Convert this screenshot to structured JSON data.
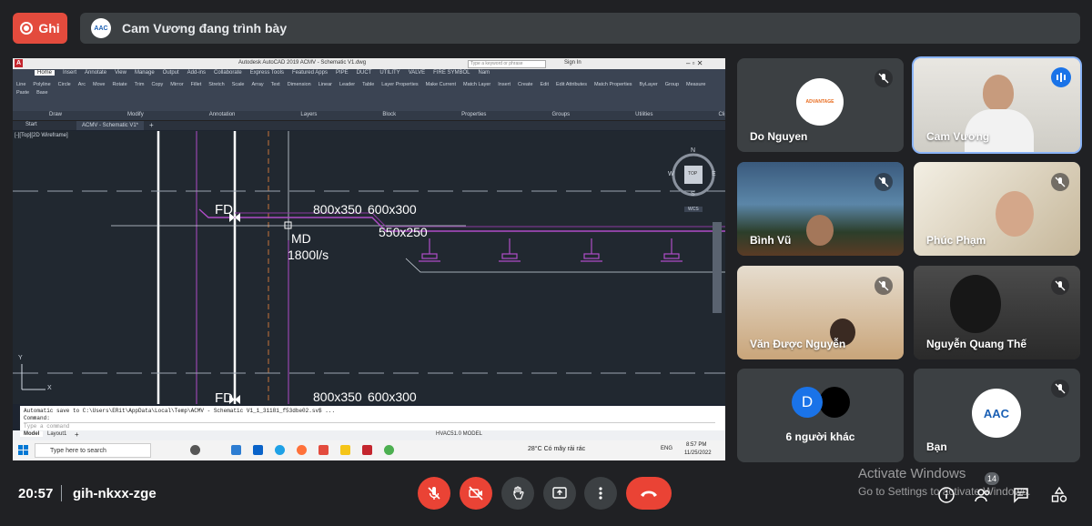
{
  "top": {
    "record_label": "Ghi",
    "presenting_text": "Cam Vương đang trình bày",
    "presenter_logo_text": "AAC"
  },
  "autocad": {
    "title": "Autodesk AutoCAD 2019   ACMV - Schematic V1.dwg",
    "search_placeholder": "Type a keyword or phrase",
    "sign_in": "Sign In",
    "menu_tabs": [
      "Home",
      "Insert",
      "Annotate",
      "View",
      "Manage",
      "Output",
      "Add-ins",
      "Collaborate",
      "Express Tools",
      "Featured Apps",
      "PIPE",
      "DUCT",
      "UTILITY",
      "VALVE",
      "FIRE SYMBOL",
      "Nam"
    ],
    "ribbon_tools": [
      "Line",
      "Polyline",
      "Circle",
      "Arc",
      "Move",
      "Rotate",
      "Trim",
      "Copy",
      "Mirror",
      "Fillet",
      "Stretch",
      "Scale",
      "Array",
      "Text",
      "Dimension",
      "Linear",
      "Leader",
      "Table",
      "Layer Properties",
      "Make Current",
      "Match Layer",
      "Insert",
      "Create",
      "Edit",
      "Edit Attributes",
      "Match Properties",
      "ByLayer",
      "Group",
      "Measure",
      "Paste",
      "Base"
    ],
    "ribbon_groups": [
      "Draw",
      "Modify",
      "Annotation",
      "Layers",
      "Block",
      "Properties",
      "Groups",
      "Utilities",
      "Clipboard",
      "View"
    ],
    "doc_tabs": [
      "Start",
      "ACMV - Schematic V1*"
    ],
    "viewport_label": "[-][Top][2D Wireframe]",
    "viewcube": {
      "top": "TOP",
      "n": "N",
      "s": "S",
      "e": "E",
      "w": "W",
      "wcs": "WCS"
    },
    "drawing_labels": {
      "fd_top": "FD",
      "duct_a": "800x350",
      "duct_b": "600x300",
      "duct_c": "550x250",
      "md": "MD",
      "flow": "1800l/s",
      "fd_bottom": "FD",
      "duct_a2": "800x350",
      "duct_b2": "600x300",
      "axis_y": "Y",
      "axis_x": "X"
    },
    "command_history": "Automatic save to C:\\Users\\ERit\\AppData\\Local\\Temp\\ACMV - Schematic V1_1_31181_f53dbe02.sv$ ...",
    "command_label": "Command:",
    "command_placeholder": "Type a command",
    "layout_tabs": [
      "Model",
      "Layout1"
    ],
    "status_text": "HVAC51.0   MODEL"
  },
  "windows_taskbar": {
    "search_placeholder": "Type here to search",
    "weather": "28°C  Có mây rải rác",
    "lang": "ENG",
    "time": "8:57 PM",
    "date": "11/25/2022"
  },
  "participants": [
    {
      "name": "Do Nguyen",
      "logo_text": "ADVANTAGE",
      "muted": true
    },
    {
      "name": "Cam Vương",
      "speaking": true
    },
    {
      "name": "Bình Vũ",
      "muted": true
    },
    {
      "name": "Phúc Phạm",
      "muted": true
    },
    {
      "name": "Văn Được Nguyễn",
      "muted": true
    },
    {
      "name": "Nguyễn Quang Thế",
      "muted": true
    },
    {
      "name": "6 người khác",
      "avatar_letter": "D"
    },
    {
      "name": "Bạn",
      "logo_text": "AAC",
      "muted": true
    }
  ],
  "bottom": {
    "time": "20:57",
    "meeting_code": "gih-nkxx-zge",
    "activate_title": "Activate Windows",
    "activate_sub": "Go to Settings to activate Windows.",
    "people_count": "14"
  },
  "colors": {
    "record_red": "#e34b3d",
    "end_call_red": "#ea4335",
    "speaking_blue": "#8ab4f8",
    "background": "#202124"
  }
}
